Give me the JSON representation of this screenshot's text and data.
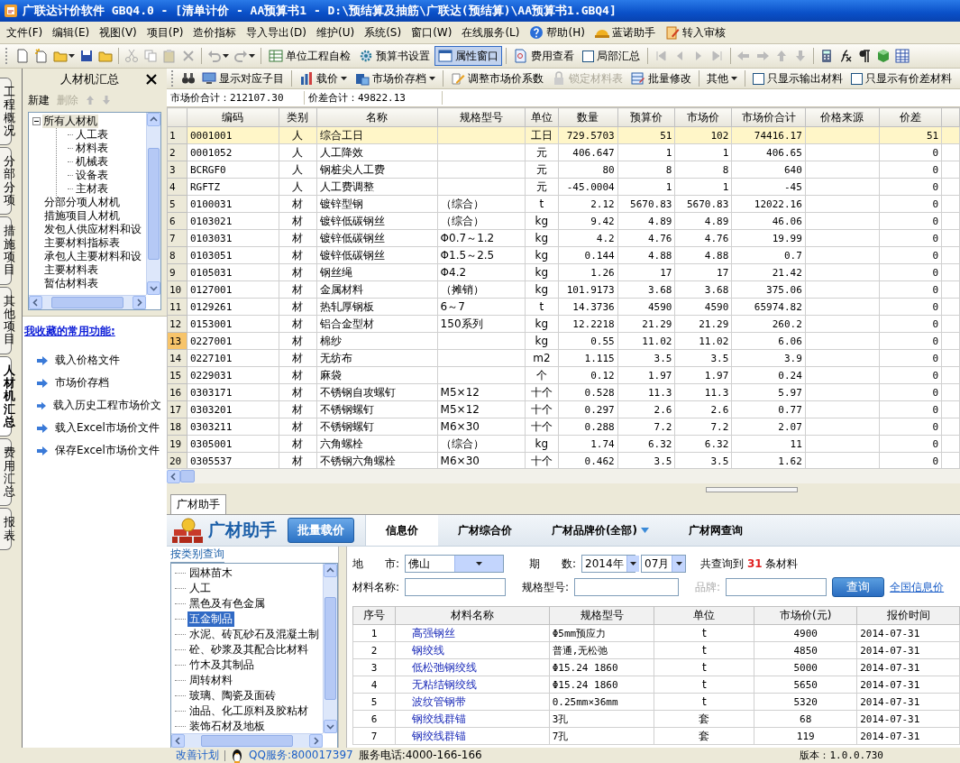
{
  "window": {
    "title": "广联达计价软件 GBQ4.0 - [清单计价 - AA预算书1 - D:\\预结算及抽筋\\广联达(预结算)\\AA预算书1.GBQ4]"
  },
  "menu": [
    {
      "label": "文件(F)",
      "kind": "text"
    },
    {
      "label": "编辑(E)",
      "kind": "text"
    },
    {
      "label": "视图(V)",
      "kind": "text"
    },
    {
      "label": "项目(P)",
      "kind": "text"
    },
    {
      "label": "造价指标",
      "kind": "text"
    },
    {
      "label": "导入导出(D)",
      "kind": "text"
    },
    {
      "label": "维护(U)",
      "kind": "text"
    },
    {
      "label": "系统(S)",
      "kind": "text"
    },
    {
      "label": "窗口(W)",
      "kind": "text"
    },
    {
      "label": "在线服务(L)",
      "kind": "text"
    },
    {
      "label": "帮助(H)",
      "kind": "help"
    },
    {
      "label": "蓝诺助手",
      "kind": "assistant"
    },
    {
      "label": "转入审核",
      "kind": "review"
    }
  ],
  "toolbar": [
    {
      "kind": "button",
      "label": "单位工程自检",
      "pressed": false
    },
    {
      "kind": "button",
      "label": "预算书设置",
      "pressed": false
    },
    {
      "kind": "button",
      "label": "属性窗口",
      "pressed": true
    },
    {
      "kind": "button",
      "label": "费用查看",
      "pressed": false
    },
    {
      "kind": "checkbox",
      "label": "局部汇总",
      "checked": false
    }
  ],
  "side_tabs": [
    {
      "label": "工程概况",
      "selected": false
    },
    {
      "label": "分部分项",
      "selected": false
    },
    {
      "label": "措施项目",
      "selected": false
    },
    {
      "label": "其他项目",
      "selected": false
    },
    {
      "label": "人材机汇总",
      "selected": true
    },
    {
      "label": "费用汇总",
      "selected": false
    },
    {
      "label": "报表",
      "selected": false
    }
  ],
  "panel": {
    "title": "人材机汇总",
    "actions": [
      {
        "label": "新建",
        "disabled": false
      },
      {
        "label": "删除",
        "disabled": true
      }
    ],
    "tree": [
      {
        "label": "所有人材机",
        "selected": true,
        "expanded": true,
        "children": [
          {
            "label": "人工表",
            "selected": false
          },
          {
            "label": "材料表",
            "selected": false
          },
          {
            "label": "机械表",
            "selected": false
          },
          {
            "label": "设备表",
            "selected": false
          },
          {
            "label": "主材表",
            "selected": false
          }
        ]
      },
      {
        "label": "分部分项人材机",
        "selected": false
      },
      {
        "label": "措施项目人材机",
        "selected": false
      },
      {
        "label": "发包人供应材料和设",
        "selected": false
      },
      {
        "label": "主要材料指标表",
        "selected": false
      },
      {
        "label": "承包人主要材料和设",
        "selected": false
      },
      {
        "label": "主要材料表",
        "selected": false
      },
      {
        "label": "暂估材料表",
        "selected": false
      }
    ],
    "favorites_title": "我收藏的常用功能:",
    "favorites": [
      "载入价格文件",
      "市场价存档",
      "载入历史工程市场价文",
      "载入Excel市场价文件",
      "保存Excel市场价文件"
    ]
  },
  "grid_toolbar": [
    {
      "kind": "button",
      "label": "显示对应子目",
      "disabled": false
    },
    {
      "kind": "dropdown",
      "label": "载价",
      "disabled": false
    },
    {
      "kind": "dropdown",
      "label": "市场价存档",
      "disabled": false
    },
    {
      "kind": "button",
      "label": "调整市场价系数",
      "disabled": false
    },
    {
      "kind": "button",
      "label": "锁定材料表",
      "disabled": true
    },
    {
      "kind": "button",
      "label": "批量修改",
      "disabled": false
    },
    {
      "kind": "dropdown",
      "label": "其他",
      "disabled": false
    },
    {
      "kind": "checkbox",
      "label": "只显示输出材料",
      "checked": false
    },
    {
      "kind": "checkbox",
      "label": "只显示有价差材料",
      "checked": false
    }
  ],
  "summary": [
    "市场价合计：212107.30",
    "价差合计：49822.13"
  ],
  "grid": {
    "columns": [
      "编码",
      "类别",
      "名称",
      "规格型号",
      "单位",
      "数量",
      "预算价",
      "市场价",
      "市场价合计",
      "价格来源",
      "价差"
    ],
    "rows": [
      {
        "no": "1",
        "selected": true,
        "current": false,
        "cells": [
          "0001001",
          "人",
          "综合工日",
          "",
          "工日",
          "729.5703",
          "51",
          "102",
          "74416.17",
          "",
          "51"
        ]
      },
      {
        "no": "2",
        "selected": false,
        "current": false,
        "cells": [
          "0001052",
          "人",
          "人工降效",
          "",
          "元",
          "406.647",
          "1",
          "1",
          "406.65",
          "",
          "0"
        ]
      },
      {
        "no": "3",
        "selected": false,
        "current": false,
        "cells": [
          "BCRGF0",
          "人",
          "钢桩尖人工费",
          "",
          "元",
          "80",
          "8",
          "8",
          "640",
          "",
          "0"
        ]
      },
      {
        "no": "4",
        "selected": false,
        "current": false,
        "cells": [
          "RGFTZ",
          "人",
          "人工费调整",
          "",
          "元",
          "-45.0004",
          "1",
          "1",
          "-45",
          "",
          "0"
        ]
      },
      {
        "no": "5",
        "selected": false,
        "current": false,
        "cells": [
          "0100031",
          "材",
          "镀锌型钢",
          "（综合）",
          "t",
          "2.12",
          "5670.83",
          "5670.83",
          "12022.16",
          "",
          "0"
        ]
      },
      {
        "no": "6",
        "selected": false,
        "current": false,
        "cells": [
          "0103021",
          "材",
          "镀锌低碳钢丝",
          "（综合）",
          "kg",
          "9.42",
          "4.89",
          "4.89",
          "46.06",
          "",
          "0"
        ]
      },
      {
        "no": "7",
        "selected": false,
        "current": false,
        "cells": [
          "0103031",
          "材",
          "镀锌低碳钢丝",
          "Φ0.7～1.2",
          "kg",
          "4.2",
          "4.76",
          "4.76",
          "19.99",
          "",
          "0"
        ]
      },
      {
        "no": "8",
        "selected": false,
        "current": false,
        "cells": [
          "0103051",
          "材",
          "镀锌低碳钢丝",
          "Φ1.5～2.5",
          "kg",
          "0.144",
          "4.88",
          "4.88",
          "0.7",
          "",
          "0"
        ]
      },
      {
        "no": "9",
        "selected": false,
        "current": false,
        "cells": [
          "0105031",
          "材",
          "钢丝绳",
          "Φ4.2",
          "kg",
          "1.26",
          "17",
          "17",
          "21.42",
          "",
          "0"
        ]
      },
      {
        "no": "10",
        "selected": false,
        "current": false,
        "cells": [
          "0127001",
          "材",
          "金属材料",
          "（摊销）",
          "kg",
          "101.9173",
          "3.68",
          "3.68",
          "375.06",
          "",
          "0"
        ]
      },
      {
        "no": "11",
        "selected": false,
        "current": false,
        "cells": [
          "0129261",
          "材",
          "热轧厚钢板",
          "6～7",
          "t",
          "14.3736",
          "4590",
          "4590",
          "65974.82",
          "",
          "0"
        ]
      },
      {
        "no": "12",
        "selected": false,
        "current": false,
        "cells": [
          "0153001",
          "材",
          "铝合金型材",
          "150系列",
          "kg",
          "12.2218",
          "21.29",
          "21.29",
          "260.2",
          "",
          "0"
        ]
      },
      {
        "no": "13",
        "selected": false,
        "current": true,
        "cells": [
          "0227001",
          "材",
          "棉纱",
          "",
          "kg",
          "0.55",
          "11.02",
          "11.02",
          "6.06",
          "",
          "0"
        ]
      },
      {
        "no": "14",
        "selected": false,
        "current": false,
        "cells": [
          "0227101",
          "材",
          "无纺布",
          "",
          "m2",
          "1.115",
          "3.5",
          "3.5",
          "3.9",
          "",
          "0"
        ]
      },
      {
        "no": "15",
        "selected": false,
        "current": false,
        "cells": [
          "0229031",
          "材",
          "麻袋",
          "",
          "个",
          "0.12",
          "1.97",
          "1.97",
          "0.24",
          "",
          "0"
        ]
      },
      {
        "no": "16",
        "selected": false,
        "current": false,
        "cells": [
          "0303171",
          "材",
          "不锈钢自攻螺钉",
          "M5×12",
          "十个",
          "0.528",
          "11.3",
          "11.3",
          "5.97",
          "",
          "0"
        ]
      },
      {
        "no": "17",
        "selected": false,
        "current": false,
        "cells": [
          "0303201",
          "材",
          "不锈钢螺钉",
          "M5×12",
          "十个",
          "0.297",
          "2.6",
          "2.6",
          "0.77",
          "",
          "0"
        ]
      },
      {
        "no": "18",
        "selected": false,
        "current": false,
        "cells": [
          "0303211",
          "材",
          "不锈钢螺钉",
          "M6×30",
          "十个",
          "0.288",
          "7.2",
          "7.2",
          "2.07",
          "",
          "0"
        ]
      },
      {
        "no": "19",
        "selected": false,
        "current": false,
        "cells": [
          "0305001",
          "材",
          "六角螺栓",
          "（综合）",
          "kg",
          "1.74",
          "6.32",
          "6.32",
          "11",
          "",
          "0"
        ]
      },
      {
        "no": "20",
        "selected": false,
        "current": false,
        "cells": [
          "0305537",
          "材",
          "不锈钢六角螺栓",
          "M6×30",
          "十个",
          "0.462",
          "3.5",
          "3.5",
          "1.62",
          "",
          "0"
        ]
      }
    ]
  },
  "assistant": {
    "tab": "广材助手",
    "brand": "广材助手",
    "batch_button": "批量载价",
    "tabs": [
      {
        "label": "信息价",
        "selected": true,
        "dropdown": false
      },
      {
        "label": "广材综合价",
        "selected": false,
        "dropdown": false
      },
      {
        "label": "广材品牌价(全部)",
        "selected": false,
        "dropdown": true
      },
      {
        "label": "广材网查询",
        "selected": false,
        "dropdown": false
      }
    ],
    "category_title": "按类别查询",
    "categories": [
      {
        "label": "园林苗木",
        "selected": false
      },
      {
        "label": "人工",
        "selected": false
      },
      {
        "label": "黑色及有色金属",
        "selected": false
      },
      {
        "label": "五金制品",
        "selected": true
      },
      {
        "label": "水泥、砖瓦砂石及混凝土制",
        "selected": false
      },
      {
        "label": "砼、砂浆及其配合比材料",
        "selected": false
      },
      {
        "label": "竹木及其制品",
        "selected": false
      },
      {
        "label": "周转材料",
        "selected": false
      },
      {
        "label": "玻璃、陶瓷及面砖",
        "selected": false
      },
      {
        "label": "油品、化工原料及胶粘材",
        "selected": false
      },
      {
        "label": "装饰石材及地板",
        "selected": false
      }
    ],
    "form": {
      "city_label": "地　　市:",
      "city": "佛山",
      "period_label": "期　　数:",
      "year": "2014年",
      "month": "07月",
      "result_count": "共查询到 **31** 条材料",
      "name_label": "材料名称:",
      "spec_label": "规格型号:",
      "brand_label": "品牌:",
      "brand_disabled": true,
      "search_button": "查询",
      "national_link": "全国信息价"
    },
    "results": {
      "columns": [
        "序号",
        "材料名称",
        "规格型号",
        "单位",
        "市场价(元)",
        "报价时间"
      ],
      "rows": [
        [
          "1",
          "高强钢丝",
          "Φ5mm预应力",
          "t",
          "4900",
          "2014-07-31"
        ],
        [
          "2",
          "钢绞线",
          "普通,无松弛",
          "t",
          "4850",
          "2014-07-31"
        ],
        [
          "3",
          "低松弛钢绞线",
          "Φ15.24 1860",
          "t",
          "5000",
          "2014-07-31"
        ],
        [
          "4",
          "无粘结钢绞线",
          "Φ15.24 1860",
          "t",
          "5650",
          "2014-07-31"
        ],
        [
          "5",
          "波纹管钢带",
          "0.25mm×36mm",
          "t",
          "5320",
          "2014-07-31"
        ],
        [
          "6",
          "钢绞线群锚",
          "3孔",
          "套",
          "68",
          "2014-07-31"
        ],
        [
          "7",
          "钢绞线群锚",
          "7孔",
          "套",
          "119",
          "2014-07-31"
        ]
      ]
    }
  },
  "status_bar": {
    "improve_link": "改善计划",
    "qq": "QQ服务:800017397",
    "phone": "服务电话:4000-166-166",
    "version": "版本：1.0.0.730"
  }
}
